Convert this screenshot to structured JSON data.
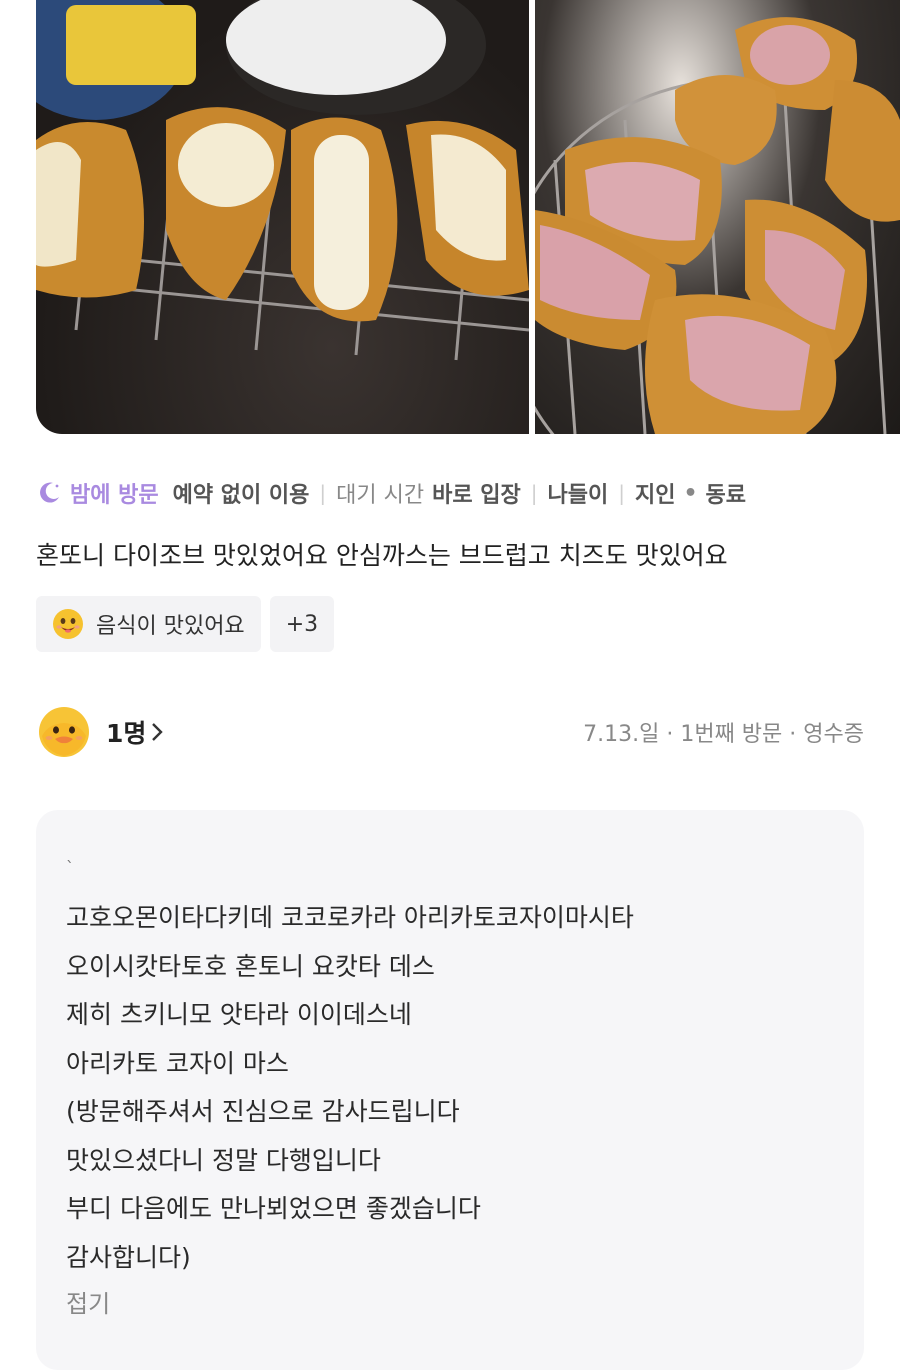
{
  "photos": [
    {
      "alt": ""
    },
    {
      "alt": ""
    }
  ],
  "tags": {
    "visit_time": "밤에 방문",
    "reservation": "예약 없이 이용",
    "wait_label": "대기 시간",
    "wait_value": "바로 입장",
    "purpose": "나들이",
    "companion_1": "지인",
    "companion_sep": "•",
    "companion_2": "동료",
    "accent_color": "#a98ae0"
  },
  "review_text": "혼또니 다이조브 맛있었어요 안심까스는 브드럽고 치즈도 맛있어요",
  "chips": {
    "keyword": "음식이 맛있어요",
    "keyword_icon": "smiley-emoji-icon",
    "more": "+3"
  },
  "reviewer": {
    "name": "1명",
    "avatar_icon": "duck-avatar-icon",
    "meta": "7.13.일 · 1번째 방문 · 영수증"
  },
  "reply": {
    "mark": "`",
    "lines": [
      "고호오몬이타다키데 코코로카라 아리카토코자이마시타",
      "오이시캇타토호 혼토니 요캇타 데스",
      "제히 츠키니모 앗타라 이이데스네",
      "아리카토 코자이 마스",
      "(방문해주셔서 진심으로 감사드립니다",
      "맛있으셨다니 정말 다행입니다",
      "부디 다음에도 만나뵈었으면 좋겠습니다",
      "감사합니다)"
    ],
    "fold": "접기"
  }
}
